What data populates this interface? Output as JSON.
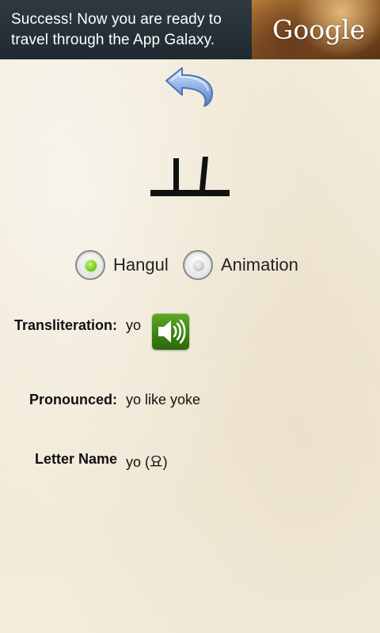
{
  "ad": {
    "line1": "Success! Now you are ready to",
    "line2": "travel through the App Galaxy.",
    "brand": "Google"
  },
  "letter": {
    "glyph": "ㅛ"
  },
  "view_mode": {
    "options": [
      {
        "label": "Hangul",
        "selected": true
      },
      {
        "label": "Animation",
        "selected": false
      }
    ]
  },
  "info": {
    "transliteration_label": "Transliteration:",
    "transliteration_value": "yo",
    "pronounced_label": "Pronounced:",
    "pronounced_value": "yo like yoke",
    "letter_name_label": "Letter Name",
    "letter_name_value": "yo (요)"
  },
  "icons": {
    "back": "back-arrow-icon",
    "speaker": "speaker-icon"
  },
  "colors": {
    "background": "#f3ecdc",
    "radio_selected": "#7fcf1f",
    "speaker_button": "#3d8414"
  }
}
